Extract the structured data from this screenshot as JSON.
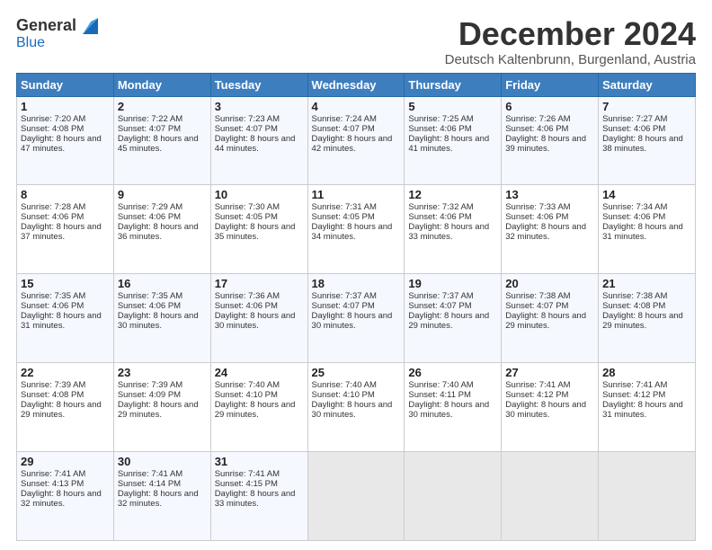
{
  "logo": {
    "general": "General",
    "blue": "Blue"
  },
  "header": {
    "title": "December 2024",
    "subtitle": "Deutsch Kaltenbrunn, Burgenland, Austria"
  },
  "columns": [
    "Sunday",
    "Monday",
    "Tuesday",
    "Wednesday",
    "Thursday",
    "Friday",
    "Saturday"
  ],
  "weeks": [
    [
      {
        "day": "1",
        "sunrise": "7:20 AM",
        "sunset": "4:08 PM",
        "daylight": "8 hours and 47 minutes."
      },
      {
        "day": "2",
        "sunrise": "7:22 AM",
        "sunset": "4:07 PM",
        "daylight": "8 hours and 45 minutes."
      },
      {
        "day": "3",
        "sunrise": "7:23 AM",
        "sunset": "4:07 PM",
        "daylight": "8 hours and 44 minutes."
      },
      {
        "day": "4",
        "sunrise": "7:24 AM",
        "sunset": "4:07 PM",
        "daylight": "8 hours and 42 minutes."
      },
      {
        "day": "5",
        "sunrise": "7:25 AM",
        "sunset": "4:06 PM",
        "daylight": "8 hours and 41 minutes."
      },
      {
        "day": "6",
        "sunrise": "7:26 AM",
        "sunset": "4:06 PM",
        "daylight": "8 hours and 39 minutes."
      },
      {
        "day": "7",
        "sunrise": "7:27 AM",
        "sunset": "4:06 PM",
        "daylight": "8 hours and 38 minutes."
      }
    ],
    [
      {
        "day": "8",
        "sunrise": "7:28 AM",
        "sunset": "4:06 PM",
        "daylight": "8 hours and 37 minutes."
      },
      {
        "day": "9",
        "sunrise": "7:29 AM",
        "sunset": "4:06 PM",
        "daylight": "8 hours and 36 minutes."
      },
      {
        "day": "10",
        "sunrise": "7:30 AM",
        "sunset": "4:05 PM",
        "daylight": "8 hours and 35 minutes."
      },
      {
        "day": "11",
        "sunrise": "7:31 AM",
        "sunset": "4:05 PM",
        "daylight": "8 hours and 34 minutes."
      },
      {
        "day": "12",
        "sunrise": "7:32 AM",
        "sunset": "4:06 PM",
        "daylight": "8 hours and 33 minutes."
      },
      {
        "day": "13",
        "sunrise": "7:33 AM",
        "sunset": "4:06 PM",
        "daylight": "8 hours and 32 minutes."
      },
      {
        "day": "14",
        "sunrise": "7:34 AM",
        "sunset": "4:06 PM",
        "daylight": "8 hours and 31 minutes."
      }
    ],
    [
      {
        "day": "15",
        "sunrise": "7:35 AM",
        "sunset": "4:06 PM",
        "daylight": "8 hours and 31 minutes."
      },
      {
        "day": "16",
        "sunrise": "7:35 AM",
        "sunset": "4:06 PM",
        "daylight": "8 hours and 30 minutes."
      },
      {
        "day": "17",
        "sunrise": "7:36 AM",
        "sunset": "4:06 PM",
        "daylight": "8 hours and 30 minutes."
      },
      {
        "day": "18",
        "sunrise": "7:37 AM",
        "sunset": "4:07 PM",
        "daylight": "8 hours and 30 minutes."
      },
      {
        "day": "19",
        "sunrise": "7:37 AM",
        "sunset": "4:07 PM",
        "daylight": "8 hours and 29 minutes."
      },
      {
        "day": "20",
        "sunrise": "7:38 AM",
        "sunset": "4:07 PM",
        "daylight": "8 hours and 29 minutes."
      },
      {
        "day": "21",
        "sunrise": "7:38 AM",
        "sunset": "4:08 PM",
        "daylight": "8 hours and 29 minutes."
      }
    ],
    [
      {
        "day": "22",
        "sunrise": "7:39 AM",
        "sunset": "4:08 PM",
        "daylight": "8 hours and 29 minutes."
      },
      {
        "day": "23",
        "sunrise": "7:39 AM",
        "sunset": "4:09 PM",
        "daylight": "8 hours and 29 minutes."
      },
      {
        "day": "24",
        "sunrise": "7:40 AM",
        "sunset": "4:10 PM",
        "daylight": "8 hours and 29 minutes."
      },
      {
        "day": "25",
        "sunrise": "7:40 AM",
        "sunset": "4:10 PM",
        "daylight": "8 hours and 30 minutes."
      },
      {
        "day": "26",
        "sunrise": "7:40 AM",
        "sunset": "4:11 PM",
        "daylight": "8 hours and 30 minutes."
      },
      {
        "day": "27",
        "sunrise": "7:41 AM",
        "sunset": "4:12 PM",
        "daylight": "8 hours and 30 minutes."
      },
      {
        "day": "28",
        "sunrise": "7:41 AM",
        "sunset": "4:12 PM",
        "daylight": "8 hours and 31 minutes."
      }
    ],
    [
      {
        "day": "29",
        "sunrise": "7:41 AM",
        "sunset": "4:13 PM",
        "daylight": "8 hours and 32 minutes."
      },
      {
        "day": "30",
        "sunrise": "7:41 AM",
        "sunset": "4:14 PM",
        "daylight": "8 hours and 32 minutes."
      },
      {
        "day": "31",
        "sunrise": "7:41 AM",
        "sunset": "4:15 PM",
        "daylight": "8 hours and 33 minutes."
      },
      null,
      null,
      null,
      null
    ]
  ],
  "labels": {
    "sunrise": "Sunrise:",
    "sunset": "Sunset:",
    "daylight": "Daylight:"
  }
}
